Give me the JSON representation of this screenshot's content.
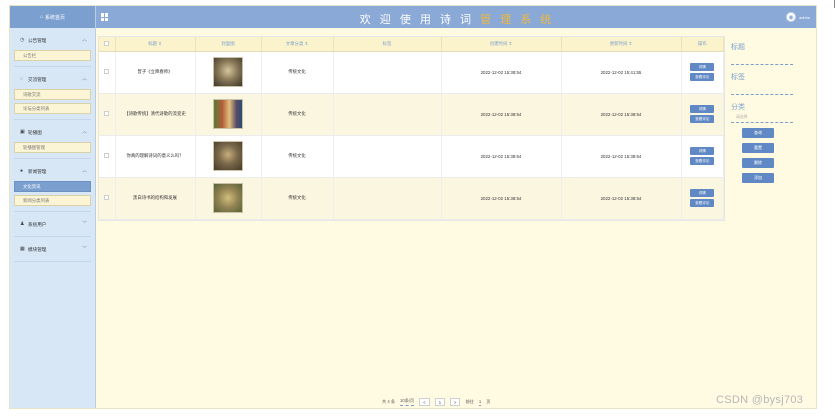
{
  "brand": {
    "label": "系统首页"
  },
  "header": {
    "title_prefix": "欢 迎 使 用 诗 词 ",
    "title_highlight": "管 理 系 统",
    "username": "admin"
  },
  "sidebar": {
    "groups": [
      {
        "label": "公告管理",
        "icon": "clock-icon",
        "items": [
          "公告栏"
        ]
      },
      {
        "label": "交流管理",
        "icon": "chat-icon",
        "items": [
          "诗歌交流",
          "论坛分类列表"
        ]
      },
      {
        "label": "轮播图",
        "icon": "image-icon",
        "items": [
          "轮播图管理"
        ]
      },
      {
        "label": "新闻管理",
        "icon": "pin-icon",
        "items": [
          "文化资讯",
          "新闻分类列表"
        ]
      },
      {
        "label": "系统用户",
        "icon": "user-icon",
        "items": []
      },
      {
        "label": "模块管理",
        "icon": "grid-icon",
        "items": []
      }
    ],
    "active_item": "文化资讯"
  },
  "table": {
    "columns": [
      "标题 ⇕",
      "封面图",
      "文章分类 ⇕",
      "标签",
      "创建时间 ⇕",
      "更新时间 ⇕",
      "操作"
    ],
    "rows": [
      {
        "title": "曾子《立降春师》",
        "category": "传统文化",
        "tag": "",
        "created": "2022-12-02 15:38:54",
        "updated": "2022-12-02 15:41:55",
        "thumb": "t1"
      },
      {
        "title": "【诗歌传统】清代诗歌的流变史",
        "category": "传统文化",
        "tag": "",
        "created": "2022-12-02 15:38:54",
        "updated": "2022-12-02 15:38:54",
        "thumb": "t2"
      },
      {
        "title": "你真的理解诗词的意义么吗？",
        "category": "传统文化",
        "tag": "",
        "created": "2022-12-02 15:38:54",
        "updated": "2022-12-02 15:38:54",
        "thumb": "t3"
      },
      {
        "title": "黑白诗书的结构和发展",
        "category": "传统文化",
        "tag": "",
        "created": "2022-12-02 15:38:54",
        "updated": "2022-12-02 15:38:54",
        "thumb": "t4"
      }
    ],
    "row_buttons": {
      "detail": "详情",
      "comment": "查看评论"
    }
  },
  "pager": {
    "total": "共 4 条",
    "page_size": "10条/页",
    "prev": "<",
    "current": "1",
    "next": ">",
    "goto_label": "前往",
    "goto_value": "1",
    "goto_suffix": "页"
  },
  "filter": {
    "title_label": "标题",
    "tag_label": "标签",
    "category_label": "分类",
    "category_placeholder": "请选择",
    "buttons": {
      "query": "查询",
      "reset": "重置",
      "delete": "删除",
      "add": "添加"
    }
  },
  "watermark": "CSDN @bysj703"
}
